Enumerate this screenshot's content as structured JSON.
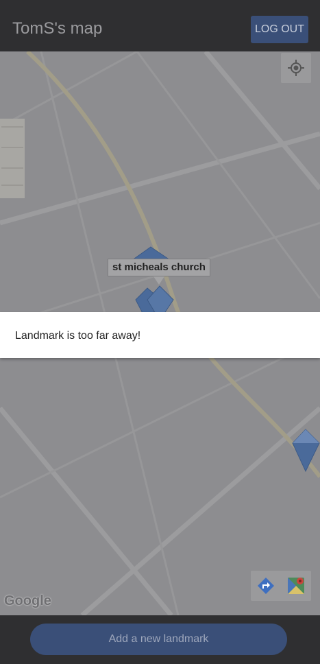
{
  "appbar": {
    "title": "TomS's map",
    "logout_label": "LOG OUT"
  },
  "map": {
    "marker_label": "st micheals church",
    "attribution": "Google",
    "icons": {
      "locate": "my-location-icon",
      "directions": "directions-icon",
      "maps": "google-maps-icon",
      "marker": "landmark-marker-icon"
    }
  },
  "toast": {
    "message": "Landmark is too far away!"
  },
  "bottom": {
    "add_label": "Add a new landmark"
  },
  "colors": {
    "appbar": "#2f2f31",
    "accent": "#3a4f78",
    "map": "#8d8d90",
    "marker": "#4a6a9a"
  }
}
